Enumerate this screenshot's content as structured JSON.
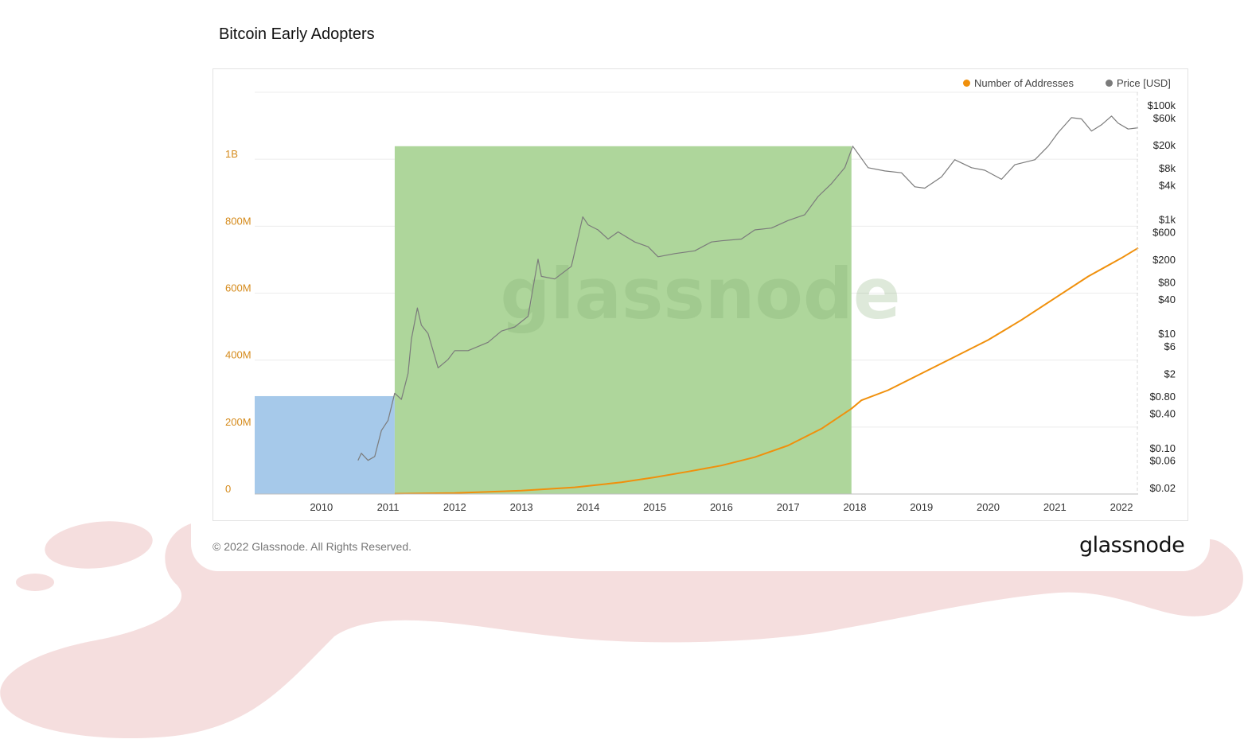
{
  "slide": {
    "title": "Bitcoin Early Adopters"
  },
  "footer": {
    "copyright": "© 2022 Glassnode. All Rights Reserved.",
    "brand": "glassnode"
  },
  "watermark": "glassnode",
  "colors": {
    "addresses": "#f0900c",
    "price": "#7b7b7b",
    "highlight_blue": "#a6c9ea",
    "highlight_green": "#aed69b",
    "blob": "#f5dede",
    "left_axis": "#d58a1a"
  },
  "legend": [
    {
      "label": "Number of Addresses",
      "color": "#f0900c"
    },
    {
      "label": "Price [USD]",
      "color": "#7b7b7b"
    }
  ],
  "chart_data": {
    "type": "line",
    "x_ticks": [
      "2010",
      "2011",
      "2012",
      "2013",
      "2014",
      "2015",
      "2016",
      "2017",
      "2018",
      "2019",
      "2020",
      "2021",
      "2022"
    ],
    "x_range": [
      2009.0,
      2022.25
    ],
    "left_axis": {
      "ticks": [
        "0",
        "200M",
        "400M",
        "600M",
        "800M",
        "1B"
      ],
      "tick_values": [
        0,
        200000000,
        400000000,
        600000000,
        800000000,
        1000000000
      ],
      "range": [
        0,
        1200000000
      ],
      "scale": "linear"
    },
    "right_axis": {
      "ticks": [
        "$100k",
        "$60k",
        "$20k",
        "$8k",
        "$4k",
        "$1k",
        "$600",
        "$200",
        "$80",
        "$40",
        "$10",
        "$6",
        "$2",
        "$0.80",
        "$0.40",
        "$0.10",
        "$0.06",
        "$0.02"
      ],
      "tick_values": [
        100000,
        60000,
        20000,
        8000,
        4000,
        1000,
        600,
        200,
        80,
        40,
        10,
        6,
        2,
        0.8,
        0.4,
        0.1,
        0.06,
        0.02
      ],
      "range": [
        0.02,
        100000
      ],
      "scale": "log"
    },
    "highlights": [
      {
        "x_range": [
          2009.0,
          2011.1
        ],
        "color": "#a6c9ea",
        "price_top": 0.8
      },
      {
        "x_range": [
          2011.1,
          2017.95
        ],
        "color": "#aed69b",
        "price_top": 19000
      }
    ],
    "series": [
      {
        "name": "Number of Addresses",
        "axis": "left",
        "points": [
          [
            2011.1,
            1000000
          ],
          [
            2012.0,
            3000000
          ],
          [
            2013.0,
            10000000
          ],
          [
            2013.8,
            20000000
          ],
          [
            2014.5,
            35000000
          ],
          [
            2015.0,
            50000000
          ],
          [
            2015.5,
            67000000
          ],
          [
            2016.0,
            85000000
          ],
          [
            2016.5,
            110000000
          ],
          [
            2017.0,
            145000000
          ],
          [
            2017.5,
            195000000
          ],
          [
            2017.95,
            255000000
          ],
          [
            2018.1,
            280000000
          ],
          [
            2018.5,
            310000000
          ],
          [
            2019.0,
            360000000
          ],
          [
            2019.5,
            410000000
          ],
          [
            2020.0,
            460000000
          ],
          [
            2020.5,
            520000000
          ],
          [
            2021.0,
            585000000
          ],
          [
            2021.5,
            650000000
          ],
          [
            2022.0,
            705000000
          ],
          [
            2022.25,
            735000000
          ]
        ]
      },
      {
        "name": "Price [USD]",
        "axis": "right",
        "points": [
          [
            2010.55,
            0.06
          ],
          [
            2010.6,
            0.08
          ],
          [
            2010.7,
            0.06
          ],
          [
            2010.8,
            0.07
          ],
          [
            2010.9,
            0.2
          ],
          [
            2011.0,
            0.3
          ],
          [
            2011.1,
            0.9
          ],
          [
            2011.2,
            0.7
          ],
          [
            2011.3,
            2.0
          ],
          [
            2011.35,
            8
          ],
          [
            2011.44,
            28
          ],
          [
            2011.5,
            14
          ],
          [
            2011.6,
            10
          ],
          [
            2011.75,
            2.5
          ],
          [
            2011.9,
            3.5
          ],
          [
            2012.0,
            5
          ],
          [
            2012.2,
            5
          ],
          [
            2012.5,
            7
          ],
          [
            2012.7,
            11
          ],
          [
            2012.9,
            13
          ],
          [
            2013.1,
            20
          ],
          [
            2013.25,
            200
          ],
          [
            2013.3,
            100
          ],
          [
            2013.5,
            90
          ],
          [
            2013.75,
            150
          ],
          [
            2013.92,
            1100
          ],
          [
            2014.0,
            800
          ],
          [
            2014.15,
            650
          ],
          [
            2014.3,
            450
          ],
          [
            2014.45,
            600
          ],
          [
            2014.7,
            400
          ],
          [
            2014.9,
            330
          ],
          [
            2015.05,
            220
          ],
          [
            2015.3,
            250
          ],
          [
            2015.6,
            280
          ],
          [
            2015.85,
            400
          ],
          [
            2016.0,
            420
          ],
          [
            2016.3,
            450
          ],
          [
            2016.5,
            650
          ],
          [
            2016.75,
            700
          ],
          [
            2017.0,
            950
          ],
          [
            2017.25,
            1200
          ],
          [
            2017.45,
            2500
          ],
          [
            2017.65,
            4200
          ],
          [
            2017.85,
            8000
          ],
          [
            2017.97,
            19000
          ],
          [
            2018.05,
            14000
          ],
          [
            2018.2,
            8000
          ],
          [
            2018.45,
            7000
          ],
          [
            2018.7,
            6500
          ],
          [
            2018.9,
            3700
          ],
          [
            2019.05,
            3500
          ],
          [
            2019.3,
            5500
          ],
          [
            2019.5,
            11000
          ],
          [
            2019.75,
            8000
          ],
          [
            2019.95,
            7200
          ],
          [
            2020.2,
            5000
          ],
          [
            2020.4,
            9000
          ],
          [
            2020.7,
            11000
          ],
          [
            2020.9,
            19000
          ],
          [
            2021.05,
            33000
          ],
          [
            2021.25,
            60000
          ],
          [
            2021.4,
            57000
          ],
          [
            2021.55,
            35000
          ],
          [
            2021.7,
            45000
          ],
          [
            2021.85,
            64000
          ],
          [
            2021.95,
            48000
          ],
          [
            2022.1,
            38000
          ],
          [
            2022.25,
            40000
          ]
        ]
      }
    ]
  }
}
